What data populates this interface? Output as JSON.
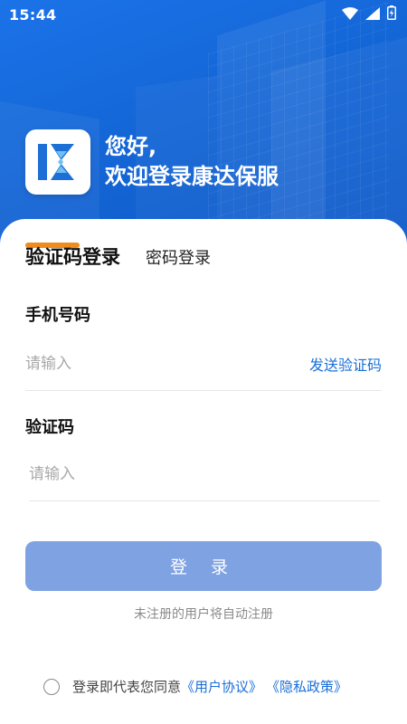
{
  "status_bar": {
    "time": "15:44"
  },
  "brand": {
    "greeting_line1": "您好,",
    "greeting_line2": "欢迎登录康达保服"
  },
  "tabs": {
    "active": "验证码登录",
    "inactive": "密码登录"
  },
  "phone": {
    "label": "手机号码",
    "placeholder": "请输入",
    "send_code": "发送验证码"
  },
  "code": {
    "label": "验证码",
    "placeholder": "请输入"
  },
  "login_button": "登 录",
  "auto_register_note": "未注册的用户将自动注册",
  "agreement": {
    "text": "登录即代表您同意",
    "user_agreement": "《用户协议》",
    "privacy_policy": "《隐私政策》"
  },
  "colors": {
    "header_blue": "#1466d6",
    "accent_orange": "#f08c1e",
    "link_blue": "#1a6fd8",
    "button_blue": "#7fa2e2"
  }
}
